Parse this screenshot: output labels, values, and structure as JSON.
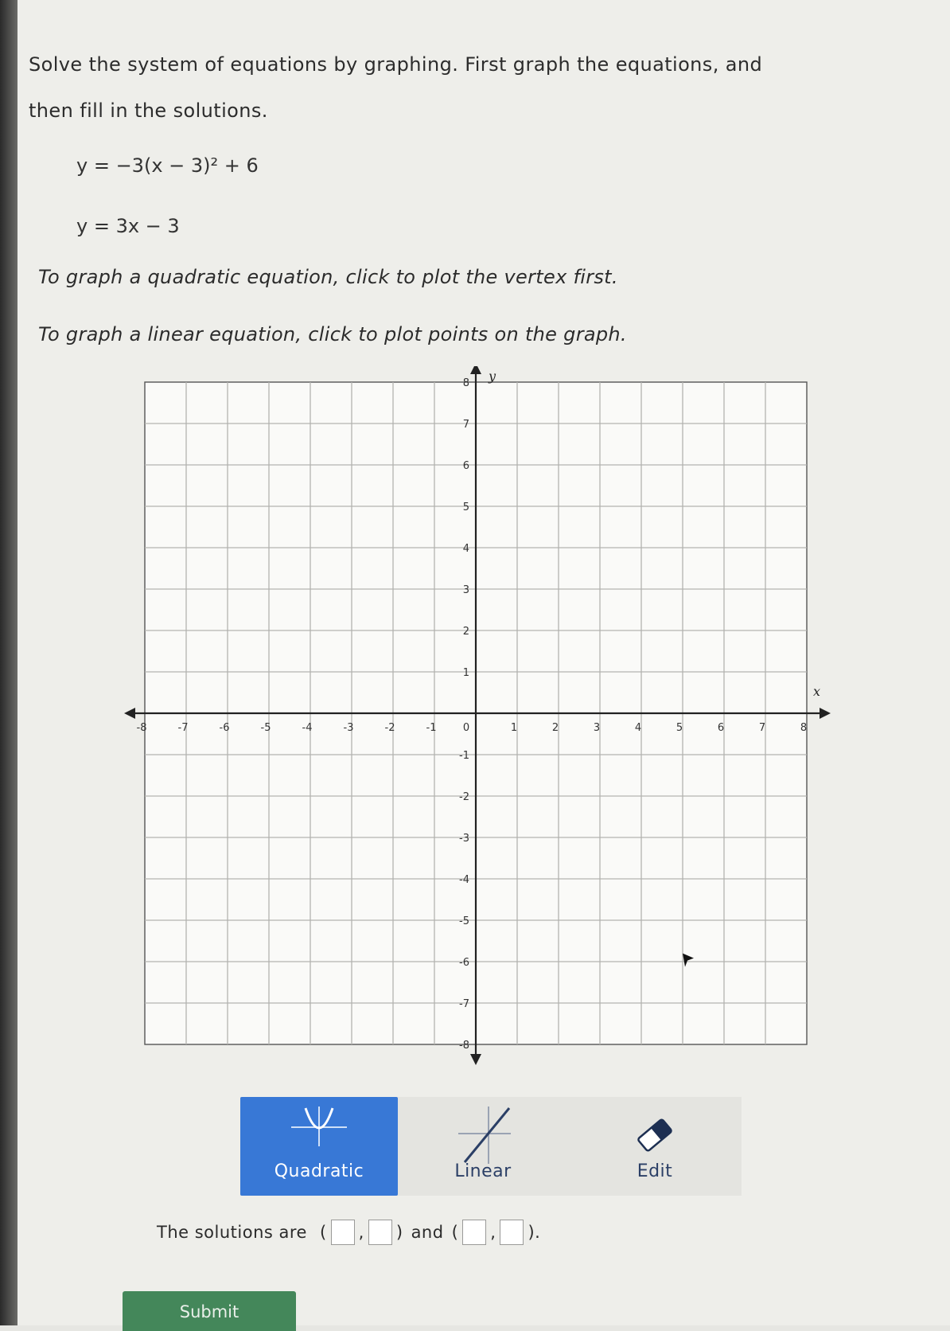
{
  "prompt": {
    "line1": "Solve the system of equations by graphing. First graph the equations, and",
    "line2": "then fill in the solutions."
  },
  "equations": {
    "eq1": "y = −3(x − 3)² + 6",
    "eq2": "y = 3x − 3"
  },
  "instructions": {
    "quadratic": "To graph a quadratic equation, click to plot the vertex first.",
    "linear": "To graph a linear equation, click to plot points on the graph."
  },
  "graph": {
    "x_axis_label": "x",
    "y_axis_label": "y",
    "x_range": [
      -8,
      8
    ],
    "y_range": [
      -8,
      8
    ],
    "x_ticks": [
      "-8",
      "-7",
      "-6",
      "-5",
      "-4",
      "-3",
      "-2",
      "-1",
      "0",
      "1",
      "2",
      "3",
      "4",
      "5",
      "6",
      "7",
      "8"
    ],
    "y_ticks": [
      "8",
      "7",
      "6",
      "5",
      "4",
      "3",
      "2",
      "1",
      "-1",
      "-2",
      "-3",
      "-4",
      "-5",
      "-6",
      "-7",
      "-8"
    ]
  },
  "toolbar": {
    "quadratic_label": "Quadratic",
    "linear_label": "Linear",
    "edit_label": "Edit",
    "selected": "Quadratic"
  },
  "solutions": {
    "prefix": "The solutions are",
    "open1": "(",
    "comma1": ",",
    "close1": ")",
    "and": "and",
    "open2": "(",
    "comma2": ",",
    "close2": ").",
    "answer1_x": "",
    "answer1_y": "",
    "answer2_x": "",
    "answer2_y": ""
  },
  "submit_label": "Submit",
  "colors": {
    "selected_tool": "#3878d6",
    "submit_button": "#44875a"
  }
}
